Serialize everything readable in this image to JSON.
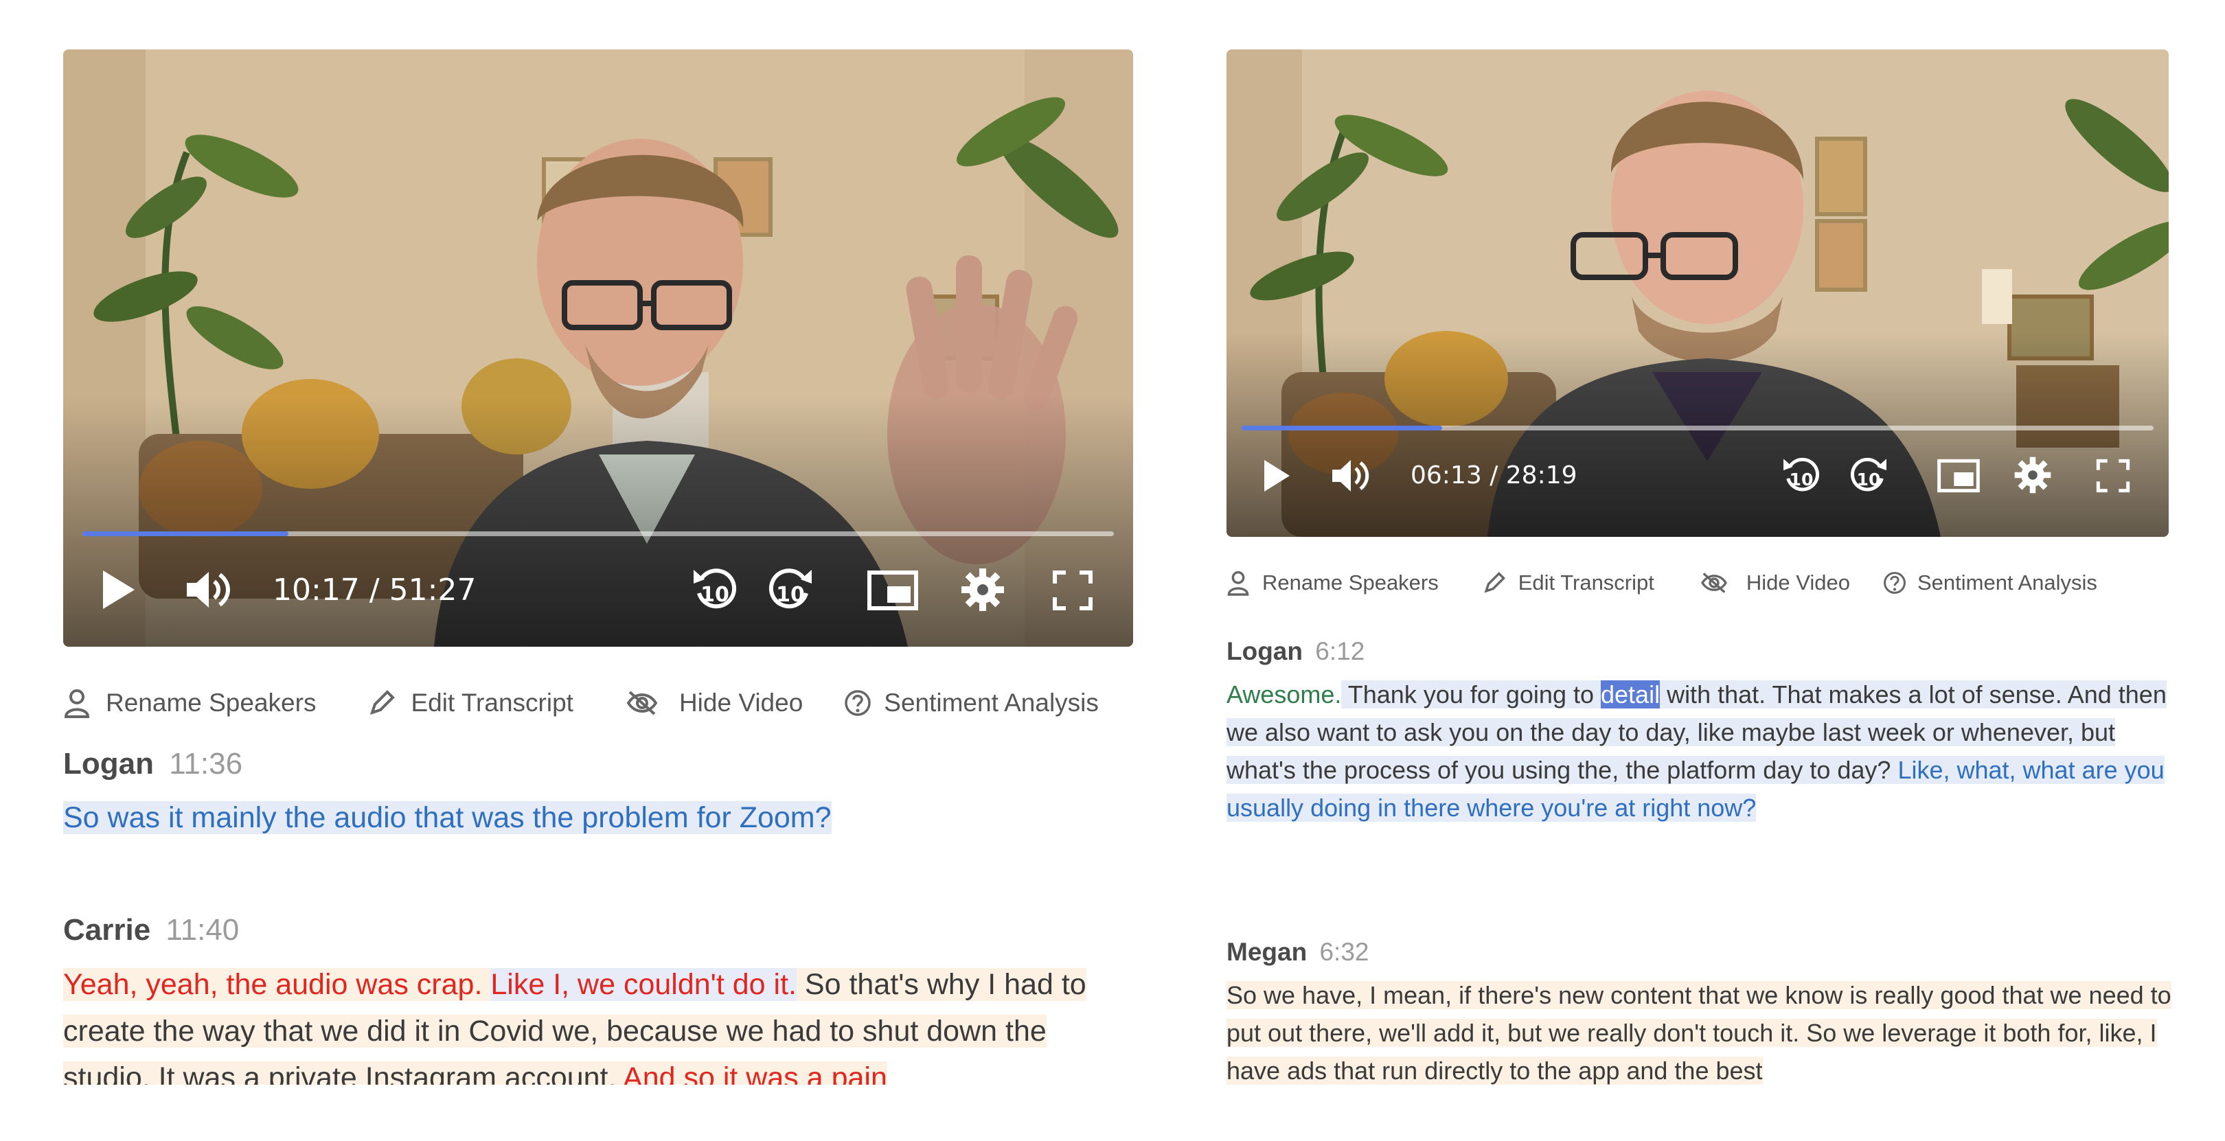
{
  "left": {
    "player": {
      "time": "10:17 / 51:27",
      "progress": 0.2,
      "skip_back": "10",
      "skip_fwd": "10"
    },
    "toolbar": {
      "rename": "Rename Speakers",
      "edit": "Edit Transcript",
      "hide": "Hide Video",
      "sentiment": "Sentiment Analysis"
    },
    "turns": [
      {
        "speaker": "Logan",
        "time": "11:36",
        "segments": [
          {
            "text": "So was it mainly the audio that was the problem for Zoom?",
            "style": "question"
          }
        ]
      },
      {
        "speaker": "Carrie",
        "time": "11:40",
        "segments": [
          {
            "text": "Yeah, yeah, the audio was crap.",
            "style": "negative"
          },
          {
            "text": " ",
            "style": "warm"
          },
          {
            "text": "Like I, we couldn't do it.",
            "style": "negative-question"
          },
          {
            "text": " So that's why I had to create the way that we did it in Covid we, because we had to shut down the studio. It was a private Instagram account. ",
            "style": "warm"
          },
          {
            "text": "And so it was a pain",
            "style": "negative"
          }
        ]
      }
    ]
  },
  "right": {
    "player": {
      "time": "06:13 / 28:19",
      "progress": 0.22,
      "skip_back": "10",
      "skip_fwd": "10"
    },
    "toolbar": {
      "rename": "Rename Speakers",
      "edit": "Edit Transcript",
      "hide": "Hide Video",
      "sentiment": "Sentiment Analysis"
    },
    "turns": [
      {
        "speaker": "Logan",
        "time": "6:12",
        "segments": [
          {
            "text": "Awesome.",
            "style": "positive"
          },
          {
            "text": " Thank you for going to ",
            "style": "plain"
          },
          {
            "text": "detail",
            "style": "highlight"
          },
          {
            "text": " with that. That makes a lot of sense. And then we also want to ask you on the day to day, like maybe last week or whenever, but what's the process of you using the, the platform day to day? ",
            "style": "plain"
          },
          {
            "text": "Like, what, what are you usually doing in there where you're at right now?",
            "style": "question"
          }
        ]
      },
      {
        "speaker": "Megan",
        "time": "6:32",
        "segments": [
          {
            "text": "So we have, I mean, if there's new content that we know is really good that we need to put out there, we'll add it, but we really don't touch it. So we leverage it both for, like, I have ads that run directly to the app and the best",
            "style": "warm"
          }
        ]
      }
    ]
  },
  "colors": {
    "accent": "#5a7be6",
    "question_text": "#2e6fbf",
    "negative_text": "#e0261f",
    "positive_text": "#2e7d4a"
  }
}
